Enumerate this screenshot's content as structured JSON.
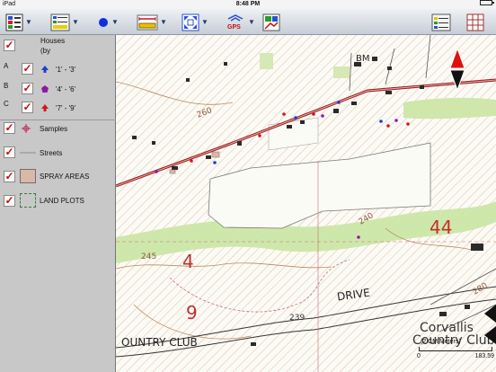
{
  "status_bar": {
    "device": "iPad",
    "time": "8:48 PM",
    "battery_percent": 100
  },
  "toolbar": {
    "buttons": [
      {
        "name": "layers-list-button",
        "icon": "layers-list-icon"
      },
      {
        "name": "legend-button",
        "icon": "legend-icon",
        "text": "PRE"
      },
      {
        "name": "point-tool-button",
        "icon": "blue-dot-icon"
      },
      {
        "name": "measure-button",
        "icon": "ruler-icon"
      },
      {
        "name": "zoom-extent-button",
        "icon": "zoom-extent-icon"
      },
      {
        "name": "gps-button",
        "icon": "gps-icon",
        "text": "GPS"
      },
      {
        "name": "map-tools-button",
        "icon": "map-tools-icon"
      },
      {
        "name": "list-view-button",
        "icon": "list-view-icon"
      },
      {
        "name": "grid-view-button",
        "icon": "grid-icon"
      }
    ]
  },
  "layers_panel": {
    "houses": {
      "label": "Houses",
      "sub": "(by",
      "checked": true
    },
    "classes": [
      {
        "letter": "A",
        "range": "'1' - '3'",
        "color": "#1a3fd0",
        "shape": "arrow"
      },
      {
        "letter": "B",
        "range": "'4' - '6'",
        "color": "#8a1aa8",
        "shape": "pentagon"
      },
      {
        "letter": "C",
        "range": "'7' - '9'",
        "color": "#d01818",
        "shape": "arrow"
      }
    ],
    "layers": [
      {
        "label": "Samples",
        "icon": "crosshair-icon",
        "checked": true
      },
      {
        "label": "Streets",
        "icon": "line-icon",
        "checked": true
      },
      {
        "label": "SPRAY AREAS",
        "icon": "polygon-fill-icon",
        "checked": true
      },
      {
        "label": "LAND PLOTS",
        "icon": "dashed-polygon-icon",
        "checked": true
      }
    ]
  },
  "map": {
    "labels": {
      "drive": "DRIVE",
      "country_club": "OUNTRY CLUB",
      "corvallis": "Corvallis",
      "country_club_right": "Country Club",
      "num_260": "260",
      "num_240": "240",
      "num_245": "245",
      "num_239": "239",
      "num_280": "280",
      "num_4": "4",
      "num_9": "9",
      "num_44": "44",
      "bm": "BM"
    },
    "scale": {
      "units": "(2 CM:Meters)",
      "left": "0",
      "right": "183.59"
    },
    "north_arrow": true
  }
}
